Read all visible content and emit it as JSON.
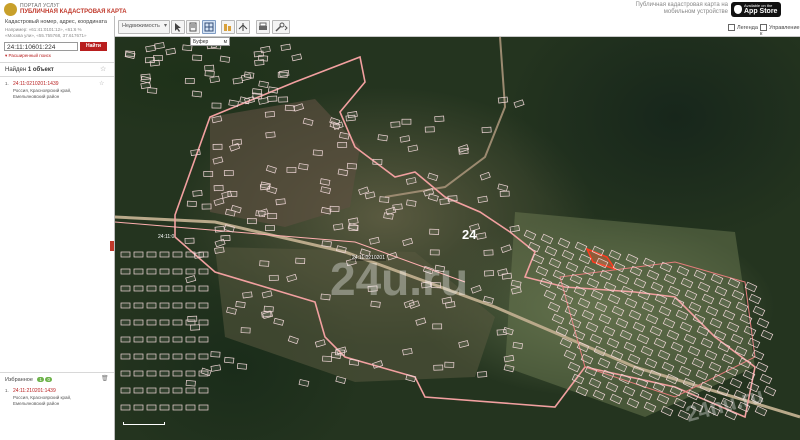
{
  "header": {
    "portal_label": "ПОРТАЛ УСЛУГ",
    "title": "ПУБЛИЧНАЯ КАДАСТРОВАЯ КАРТА",
    "layer_select": "Недвижимость",
    "promo_text": "Публичная кадастровая карта на мобильном устройстве",
    "appstore_small": "Available on the",
    "appstore_label": "App Store",
    "legend_label": "Легенда",
    "manage_label": "Управление к",
    "buffer_label": "Буфер",
    "buffer_unit": "м"
  },
  "search": {
    "label": "Кадастровый номер, адрес, координата",
    "hint1": "Например: «61:41:0101:12», «61:6 %",
    "hint2": "«Москва ули», «55.755768, 37.617671»",
    "value": "24:11:10601:224",
    "button": "Найти",
    "advanced": "▾ Расширенный поиск"
  },
  "results": {
    "found_prefix": "Найден",
    "found_count": "1 объект",
    "items": [
      {
        "num": "1.",
        "id": "24:11:0210201:1439",
        "address": "Россия, Красноярский край, Емельяновский район"
      }
    ]
  },
  "favorites": {
    "label": "Избранное",
    "count1": "1",
    "count2": "0",
    "items": [
      {
        "num": "1.",
        "id": "24:11:210201:1439",
        "address": "Россия, Красноярский край, Емельяновский район"
      }
    ]
  },
  "map": {
    "quarter_number": "24",
    "quarter_label": "24:11:0210201",
    "road_label": "24:11:0",
    "watermark1": "24u.ru",
    "watermark2": "24nu.ru"
  },
  "colors": {
    "brand_red": "#b81e1e",
    "parcel_outline": "#f0d7d7",
    "boundary": "#f2a0a0",
    "selected_parcel": "#ff3b1f"
  }
}
